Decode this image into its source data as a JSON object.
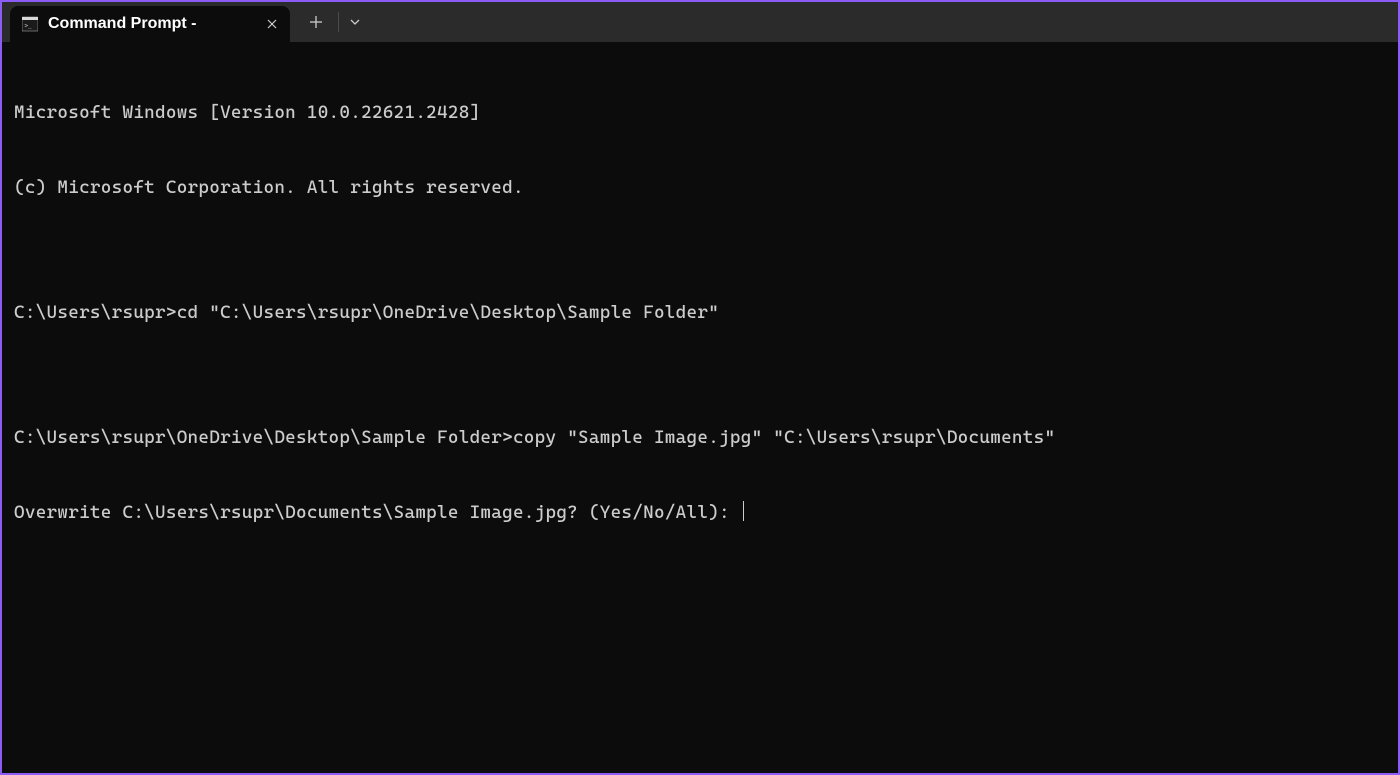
{
  "titlebar": {
    "tab": {
      "title": "Command Prompt -"
    }
  },
  "terminal": {
    "lines": [
      "Microsoft Windows [Version 10.0.22621.2428]",
      "(c) Microsoft Corporation. All rights reserved.",
      "",
      "C:\\Users\\rsupr>cd \"C:\\Users\\rsupr\\OneDrive\\Desktop\\Sample Folder\"",
      "",
      "C:\\Users\\rsupr\\OneDrive\\Desktop\\Sample Folder>copy \"Sample Image.jpg\" \"C:\\Users\\rsupr\\Documents\"",
      "Overwrite C:\\Users\\rsupr\\Documents\\Sample Image.jpg? (Yes/No/All): "
    ]
  }
}
